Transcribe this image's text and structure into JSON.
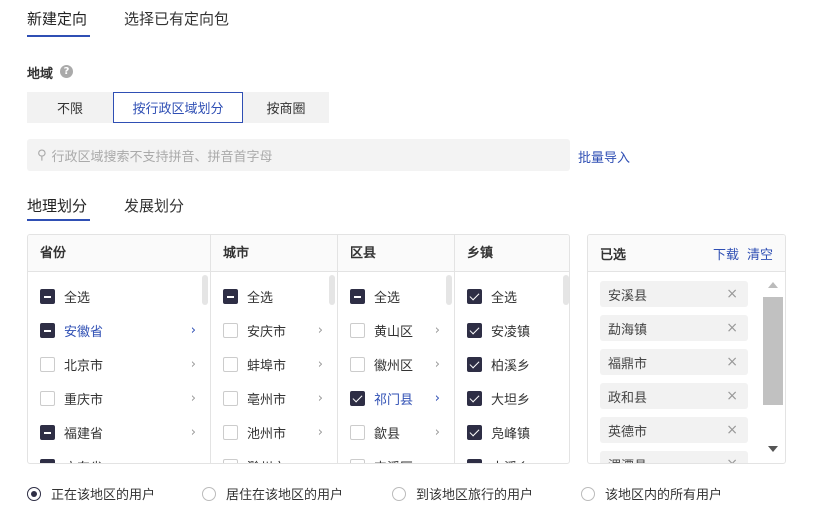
{
  "top_tabs": [
    "新建定向",
    "选择已有定向包"
  ],
  "region_label": "地域",
  "help_icon": "?",
  "segments": [
    "不限",
    "按行政区域划分",
    "按商圈"
  ],
  "search_placeholder": "行政区域搜索不支持拼音、拼音首字母",
  "bulk_import": "批量导入",
  "sub_tabs": [
    "地理划分",
    "发展划分"
  ],
  "columns": [
    {
      "header": "省份",
      "items": [
        {
          "label": "全选",
          "state": "half"
        },
        {
          "label": "安徽省",
          "state": "half",
          "active": true
        },
        {
          "label": "北京市",
          "state": "off"
        },
        {
          "label": "重庆市",
          "state": "off"
        },
        {
          "label": "福建省",
          "state": "half"
        },
        {
          "label": "广东省",
          "state": "half"
        }
      ]
    },
    {
      "header": "城市",
      "items": [
        {
          "label": "全选",
          "state": "half"
        },
        {
          "label": "安庆市",
          "state": "off"
        },
        {
          "label": "蚌埠市",
          "state": "off"
        },
        {
          "label": "亳州市",
          "state": "off"
        },
        {
          "label": "池州市",
          "state": "off"
        },
        {
          "label": "滁州市",
          "state": "off"
        }
      ]
    },
    {
      "header": "区县",
      "items": [
        {
          "label": "全选",
          "state": "half"
        },
        {
          "label": "黄山区",
          "state": "off"
        },
        {
          "label": "徽州区",
          "state": "off"
        },
        {
          "label": "祁门县",
          "state": "on",
          "active": true
        },
        {
          "label": "歙县",
          "state": "off"
        },
        {
          "label": "屯溪区",
          "state": "off"
        }
      ]
    },
    {
      "header": "乡镇",
      "items": [
        {
          "label": "全选",
          "state": "on"
        },
        {
          "label": "安凌镇",
          "state": "on"
        },
        {
          "label": "柏溪乡",
          "state": "on"
        },
        {
          "label": "大坦乡",
          "state": "on"
        },
        {
          "label": "凫峰镇",
          "state": "on"
        },
        {
          "label": "古溪乡",
          "state": "on"
        }
      ]
    }
  ],
  "selected": {
    "title": "已选",
    "download": "下载",
    "clear": "清空",
    "items": [
      "安溪县",
      "勐海镇",
      "福鼎市",
      "政和县",
      "英德市",
      "湄潭县"
    ]
  },
  "radios": [
    {
      "label": "正在该地区的用户",
      "checked": true
    },
    {
      "label": "居住在该地区的用户",
      "checked": false
    },
    {
      "label": "到该地区旅行的用户",
      "checked": false
    },
    {
      "label": "该地区内的所有用户",
      "checked": false
    }
  ]
}
